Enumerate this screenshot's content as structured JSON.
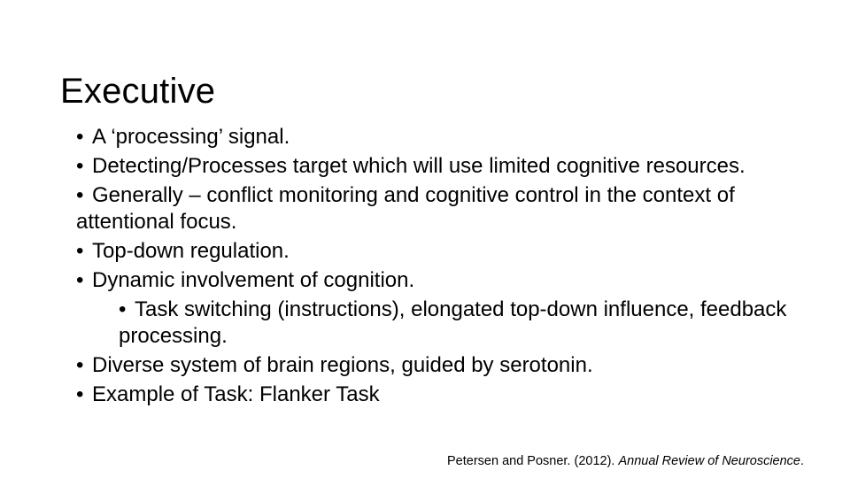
{
  "slide": {
    "title": "Executive",
    "bullet_marker": "•",
    "bullets": [
      {
        "level": 1,
        "text": "A ‘processing’ signal."
      },
      {
        "level": 1,
        "text": "Detecting/Processes target which will use limited cognitive resources."
      },
      {
        "level": 1,
        "text": "Generally – conflict monitoring and cognitive control in the context of attentional focus."
      },
      {
        "level": 1,
        "text": "Top-down regulation."
      },
      {
        "level": 1,
        "text": "Dynamic involvement of cognition."
      },
      {
        "level": 2,
        "text": "Task switching (instructions), elongated top-down influence, feedback processing."
      },
      {
        "level": 1,
        "text": "Diverse system of brain regions, guided by serotonin."
      },
      {
        "level": 1,
        "text": "Example of Task: Flanker Task"
      }
    ],
    "citation": {
      "prefix": "Petersen and Posner. (2012). ",
      "journal": "Annual Review of Neuroscience",
      "suffix": "."
    }
  }
}
